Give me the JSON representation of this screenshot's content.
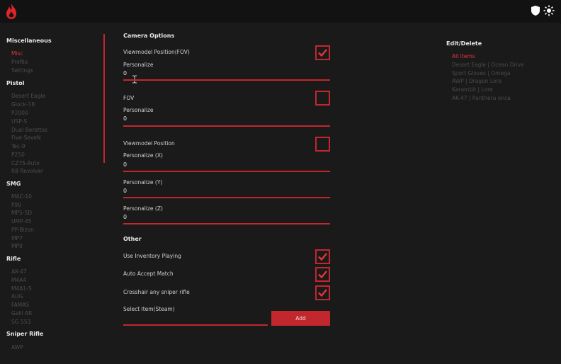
{
  "app": {
    "logo_icon": "flame-icon",
    "shield_icon": "shield-icon",
    "theme_icon": "sun-icon",
    "accent": "#c1272d"
  },
  "sidebar": {
    "sections": [
      {
        "title": "Miscellaneous",
        "items": [
          "Misc",
          "Profile",
          "Settings"
        ],
        "active": "Misc"
      },
      {
        "title": "Pistol",
        "items": [
          "Desert Eagle",
          "Glock-18",
          "P2000",
          "USP-S",
          "Dual Berettas",
          "Five-SeveN",
          "Tec-9",
          "P250",
          "CZ75-Auto",
          "R8 Revolver"
        ]
      },
      {
        "title": "SMG",
        "items": [
          "MAC-10",
          "P90",
          "MP5-SD",
          "UMP-45",
          "PP-Bizon",
          "MP7",
          "MP9"
        ]
      },
      {
        "title": "Rifle",
        "items": [
          "AK-47",
          "M4A4",
          "M4A1-S",
          "AUG",
          "FAMAS",
          "Galil AR",
          "SG 553"
        ]
      },
      {
        "title": "Sniper Rifle",
        "items": [
          "AWP"
        ]
      }
    ]
  },
  "camera": {
    "title": "Camera Options",
    "viewmodel_fov_label": "Viewmodel Position(FOV)",
    "viewmodel_fov_checked": true,
    "personalize_label": "Personalize",
    "personalize_fov_value": "0",
    "fov_label": "FOV",
    "fov_checked": false,
    "fov_personalize_label": "Personalize",
    "fov_personalize_value": "0",
    "viewmodel_position_label": "Viewmodel Position",
    "viewmodel_position_checked": false,
    "px_label": "Personalize (X)",
    "px_value": "0",
    "py_label": "Personalize (Y)",
    "py_value": "0",
    "pz_label": "Personalize (Z)",
    "pz_value": "0"
  },
  "other": {
    "title": "Other",
    "inventory_label": "Use Inventory Playing",
    "inventory_checked": true,
    "accept_label": "Auto Accept Match",
    "accept_checked": true,
    "crosshair_label": "Crosshair any sniper rifle",
    "crosshair_checked": true,
    "select_label": "Select Item(Steam)",
    "select_value": "",
    "add_label": "Add"
  },
  "edit": {
    "title": "Edit/Delete",
    "items": [
      "All Items",
      "Desert Eagle | Ocean Drive",
      "Sport Gloves | Omega",
      "AWP | Dragon Lore",
      "Karambit | Lore",
      "AK-47 | Panthera onca"
    ],
    "active": "All Items"
  }
}
